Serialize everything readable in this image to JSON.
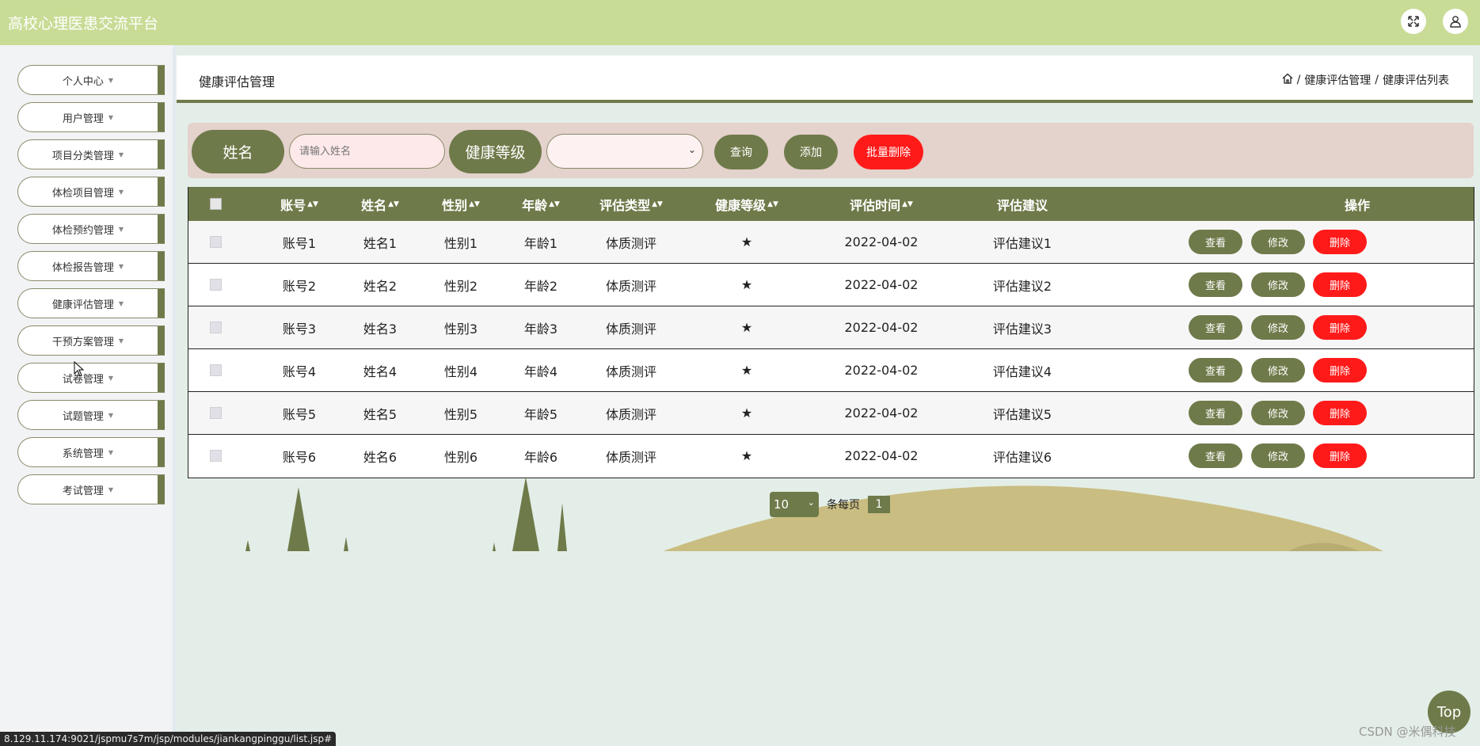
{
  "app": {
    "title": "高校心理医患交流平台"
  },
  "topbar": {
    "fullscreen_icon": "expand-icon",
    "user_icon": "user-icon"
  },
  "sidebar": {
    "items": [
      {
        "label": "个人中心"
      },
      {
        "label": "用户管理"
      },
      {
        "label": "项目分类管理"
      },
      {
        "label": "体检项目管理"
      },
      {
        "label": "体检预约管理"
      },
      {
        "label": "体检报告管理"
      },
      {
        "label": "健康评估管理"
      },
      {
        "label": "干预方案管理"
      },
      {
        "label": "试卷管理"
      },
      {
        "label": "试题管理"
      },
      {
        "label": "系统管理"
      },
      {
        "label": "考试管理"
      }
    ]
  },
  "header": {
    "title": "健康评估管理",
    "breadcrumb": [
      "健康评估管理",
      "健康评估列表"
    ],
    "separator": "/"
  },
  "search": {
    "name_label": "姓名",
    "name_placeholder": "请输入姓名",
    "level_label": "健康等级",
    "level_value": "",
    "query_button": "查询",
    "add_button": "添加",
    "batch_delete_button": "批量删除"
  },
  "table": {
    "columns": [
      "账号",
      "姓名",
      "性别",
      "年龄",
      "评估类型",
      "健康等级",
      "评估时间",
      "评估建议",
      "操作"
    ],
    "sortable": [
      true,
      true,
      true,
      true,
      true,
      true,
      true,
      false,
      false
    ],
    "rows": [
      {
        "account": "账号1",
        "name": "姓名1",
        "gender": "性别1",
        "age": "年龄1",
        "type": "体质测评",
        "level": "★",
        "time": "2022-04-02",
        "advice": "评估建议1"
      },
      {
        "account": "账号2",
        "name": "姓名2",
        "gender": "性别2",
        "age": "年龄2",
        "type": "体质测评",
        "level": "★",
        "time": "2022-04-02",
        "advice": "评估建议2"
      },
      {
        "account": "账号3",
        "name": "姓名3",
        "gender": "性别3",
        "age": "年龄3",
        "type": "体质测评",
        "level": "★",
        "time": "2022-04-02",
        "advice": "评估建议3"
      },
      {
        "account": "账号4",
        "name": "姓名4",
        "gender": "性别4",
        "age": "年龄4",
        "type": "体质测评",
        "level": "★",
        "time": "2022-04-02",
        "advice": "评估建议4"
      },
      {
        "account": "账号5",
        "name": "姓名5",
        "gender": "性别5",
        "age": "年龄5",
        "type": "体质测评",
        "level": "★",
        "time": "2022-04-02",
        "advice": "评估建议5"
      },
      {
        "account": "账号6",
        "name": "姓名6",
        "gender": "性别6",
        "age": "年龄6",
        "type": "体质测评",
        "level": "★",
        "time": "2022-04-02",
        "advice": "评估建议6"
      }
    ],
    "actions": {
      "view": "查看",
      "edit": "修改",
      "delete": "删除"
    }
  },
  "pagination": {
    "page_size": "10",
    "per_page_label": "条每页",
    "current_page": "1"
  },
  "top_button": "Top",
  "watermark": "CSDN @米偶科技",
  "status_url": "8.129.11.174:9021/jspmu7s7m/jsp/modules/jiankangpinggu/list.jsp#",
  "colors": {
    "accent": "#6f7a4a",
    "topbar": "#c8dc96",
    "danger": "#ff1a1a",
    "search_bg": "#e4d2cc"
  }
}
